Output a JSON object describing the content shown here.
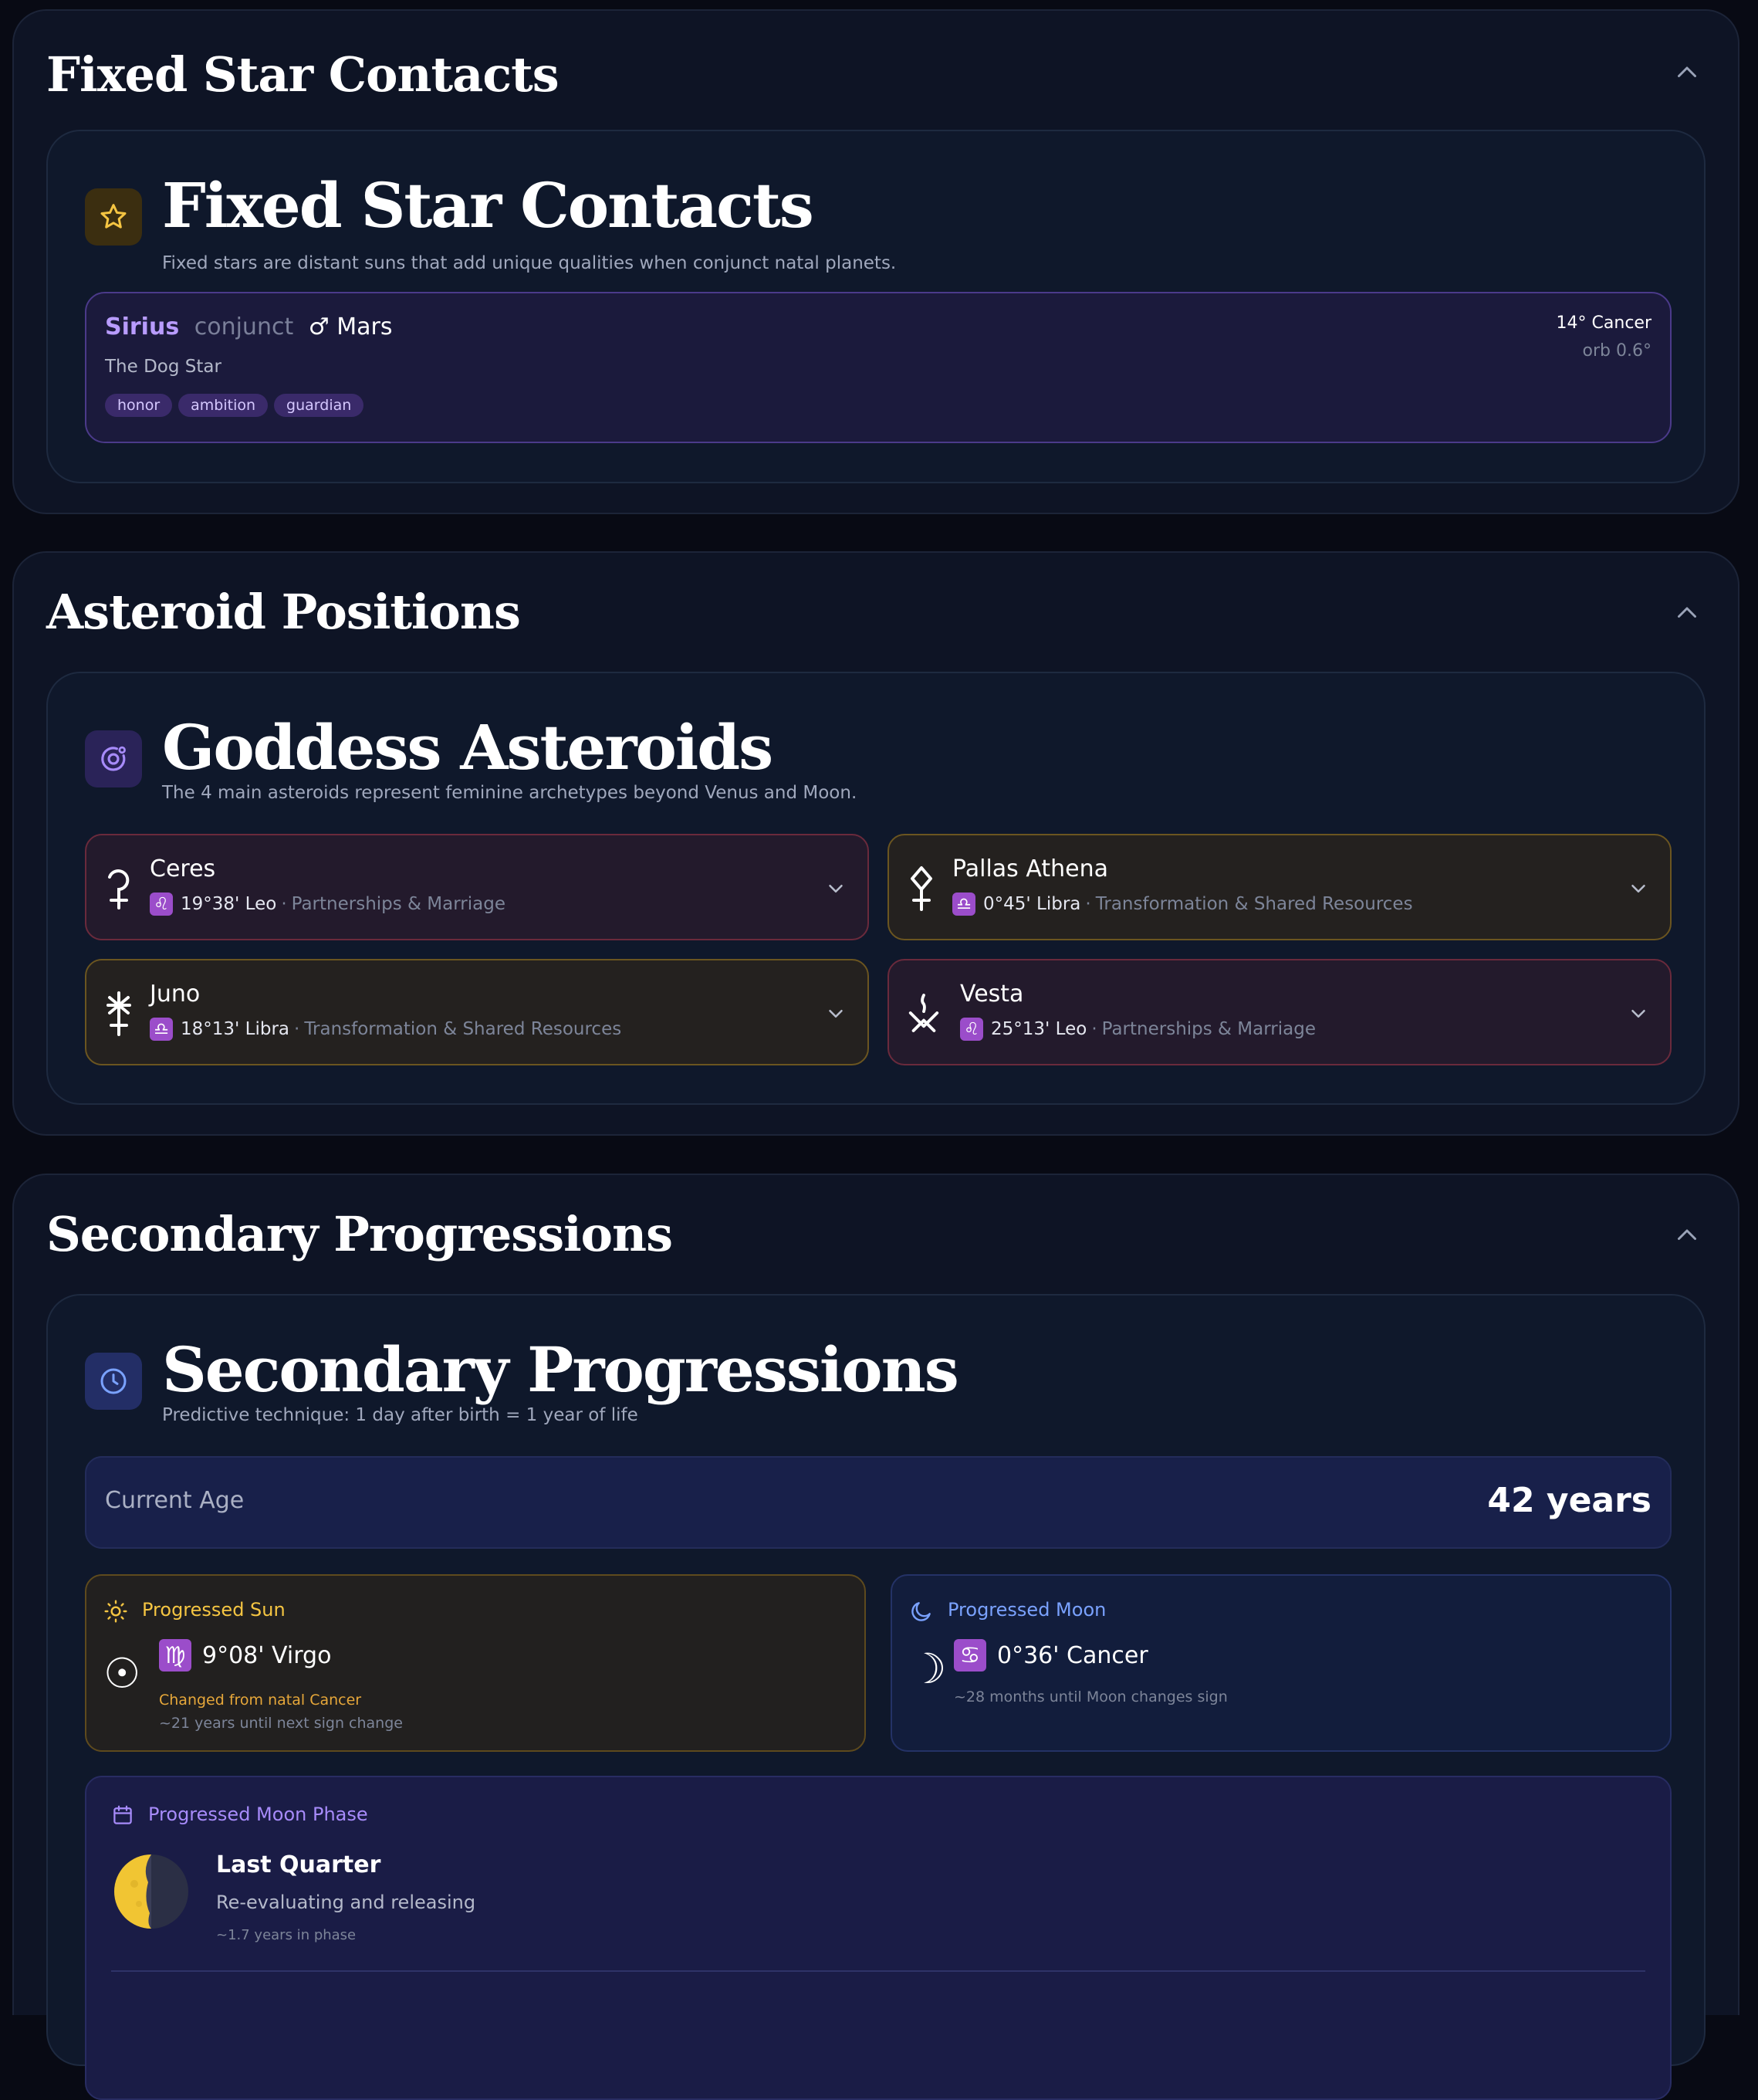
{
  "fixed_stars": {
    "section_title": "Fixed Star Contacts",
    "card_title": "Fixed Star Contacts",
    "card_subtitle": "Fixed stars are distant suns that add unique qualities when conjunct natal planets.",
    "icon": "star-icon",
    "contact": {
      "star": "Sirius",
      "aspect": "conjunct",
      "planet_symbol": "♂",
      "planet": "Mars",
      "nickname": "The Dog Star",
      "tags": [
        "honor",
        "ambition",
        "guardian"
      ],
      "position": "14° Cancer",
      "orb": "orb 0.6°"
    }
  },
  "asteroids": {
    "section_title": "Asteroid Positions",
    "card_title": "Goddess Asteroids",
    "card_subtitle": "The 4 main asteroids represent feminine archetypes beyond Venus and Moon.",
    "icon": "orbit-icon",
    "items": [
      {
        "name": "Ceres",
        "sign_symbol": "♌",
        "position": "19°38' Leo",
        "sep": "·",
        "house": "Partnerships & Marriage",
        "accent": "red",
        "glyph": "ceres-glyph-icon"
      },
      {
        "name": "Pallas Athena",
        "sign_symbol": "♎",
        "position": "0°45' Libra",
        "sep": "·",
        "house": "Transformation & Shared Resources",
        "accent": "gold",
        "glyph": "pallas-glyph-icon"
      },
      {
        "name": "Juno",
        "sign_symbol": "♎",
        "position": "18°13' Libra",
        "sep": "·",
        "house": "Transformation & Shared Resources",
        "accent": "gold",
        "glyph": "juno-glyph-icon"
      },
      {
        "name": "Vesta",
        "sign_symbol": "♌",
        "position": "25°13' Leo",
        "sep": "·",
        "house": "Partnerships & Marriage",
        "accent": "red",
        "glyph": "vesta-glyph-icon"
      }
    ]
  },
  "progressions": {
    "section_title": "Secondary Progressions",
    "card_title": "Secondary Progressions",
    "card_subtitle": "Predictive technique: 1 day after birth = 1 year of life",
    "icon": "clock-icon",
    "current_age_label": "Current Age",
    "current_age_value": "42 years",
    "sun": {
      "label": "Progressed Sun",
      "sign_symbol": "♍",
      "glyph": "☉",
      "position": "9°08' Virgo",
      "note": "Changed from natal Cancer",
      "until": "~21 years until next sign change"
    },
    "moon": {
      "label": "Progressed Moon",
      "sign_symbol": "♋",
      "glyph": "☽",
      "position": "0°36' Cancer",
      "until": "~28 months until Moon changes sign"
    },
    "phase": {
      "label": "Progressed Moon Phase",
      "name": "Last Quarter",
      "description": "Re-evaluating and releasing",
      "duration": "~1.7 years in phase"
    }
  },
  "colors": {
    "accent_purple": "#a78bfa",
    "accent_gold": "#f5c542",
    "accent_blue": "#7aa2ff",
    "sign_badge": "#9b4dca"
  }
}
